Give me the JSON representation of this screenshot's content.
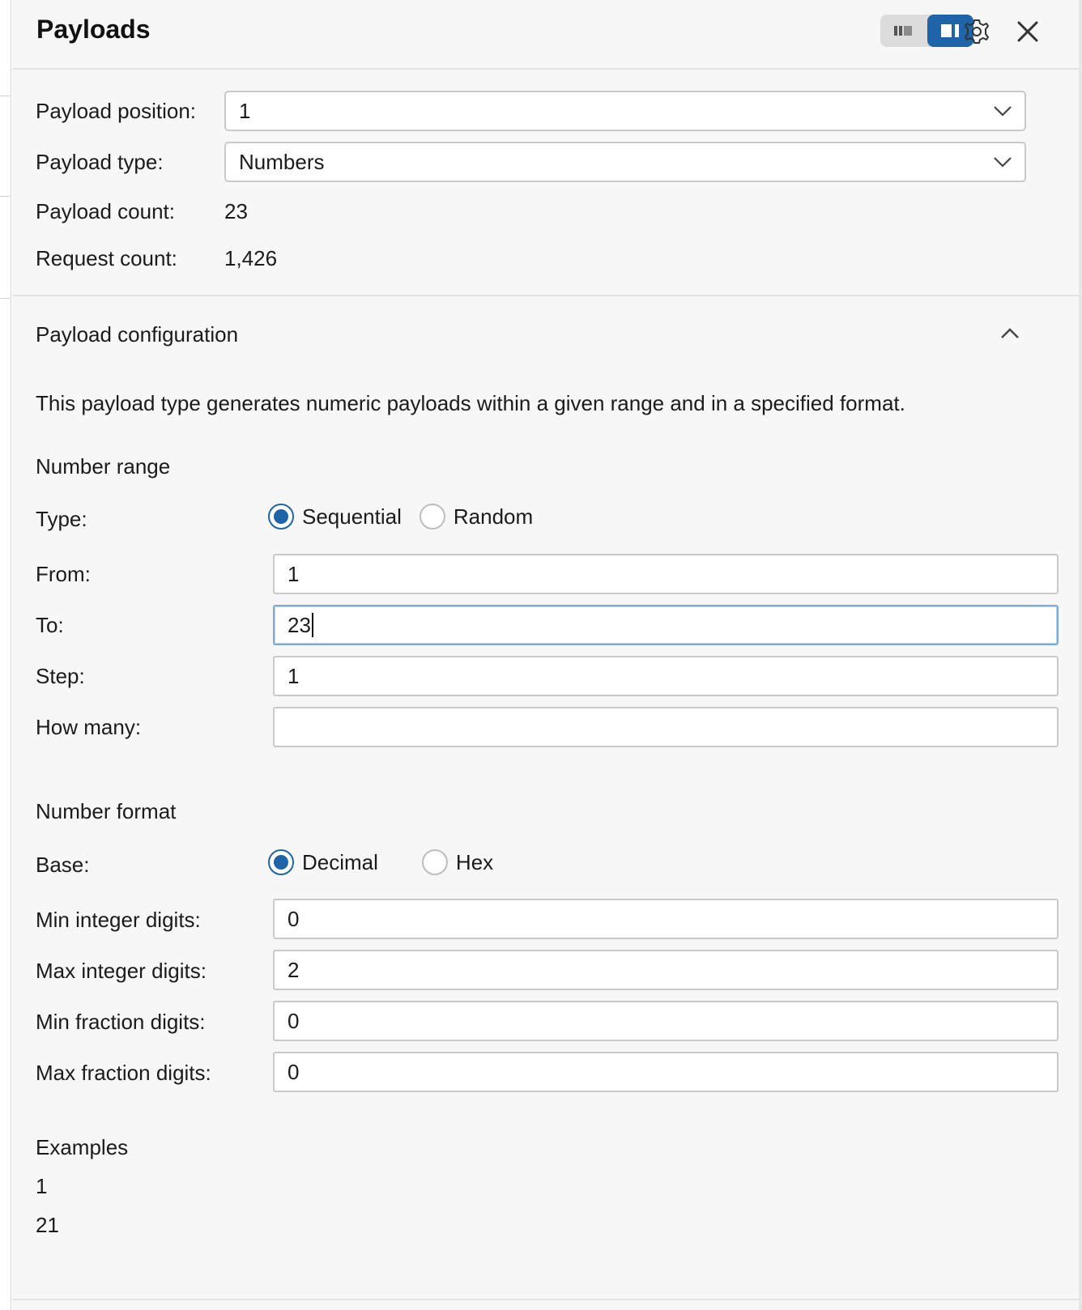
{
  "header": {
    "title": "Payloads",
    "icons": [
      "layout-left-icon",
      "layout-right-icon",
      "gear-icon",
      "close-icon"
    ]
  },
  "summary": {
    "position_label": "Payload position:",
    "position_value": "1",
    "type_label": "Payload type:",
    "type_value": "Numbers",
    "payload_count_label": "Payload count:",
    "payload_count_value": "23",
    "request_count_label": "Request count:",
    "request_count_value": "1,426"
  },
  "config": {
    "section_title": "Payload configuration",
    "description": "This payload type generates numeric payloads within a given range and in a specified format.",
    "number_range": {
      "heading": "Number range",
      "type_label": "Type:",
      "type_options": [
        "Sequential",
        "Random"
      ],
      "type_selected": "Sequential",
      "from_label": "From:",
      "from_value": "1",
      "to_label": "To:",
      "to_value": "23",
      "step_label": "Step:",
      "step_value": "1",
      "how_many_label": "How many:",
      "how_many_value": ""
    },
    "number_format": {
      "heading": "Number format",
      "base_label": "Base:",
      "base_options": [
        "Decimal",
        "Hex"
      ],
      "base_selected": "Decimal",
      "min_int_label": "Min integer digits:",
      "min_int_value": "0",
      "max_int_label": "Max integer digits:",
      "max_int_value": "2",
      "min_frac_label": "Min fraction digits:",
      "min_frac_value": "0",
      "max_frac_label": "Max fraction digits:",
      "max_frac_value": "0"
    },
    "examples": {
      "heading": "Examples",
      "items": [
        "1",
        "21"
      ]
    }
  },
  "colors": {
    "accent": "#1f63a8",
    "panel_bg": "#f7f7f7"
  }
}
